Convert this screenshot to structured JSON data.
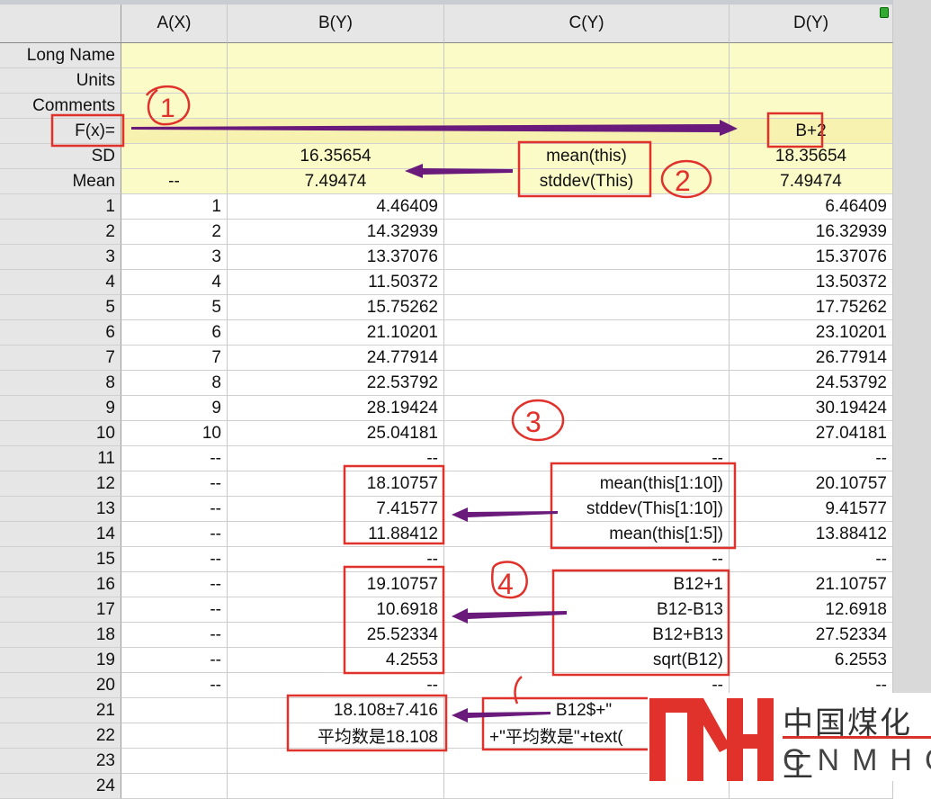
{
  "columns": [
    "A(X)",
    "B(Y)",
    "C(Y)",
    "D(Y)"
  ],
  "meta_rows": [
    {
      "label": "Long Name",
      "cells": [
        "",
        "",
        "",
        ""
      ]
    },
    {
      "label": "Units",
      "cells": [
        "",
        "",
        "",
        ""
      ]
    },
    {
      "label": "Comments",
      "cells": [
        "",
        "",
        "",
        ""
      ]
    },
    {
      "label": "F(x)=",
      "cells": [
        "",
        "",
        "",
        "B+2"
      ]
    },
    {
      "label": "SD",
      "cells": [
        "",
        "16.35654",
        "mean(this)",
        "18.35654"
      ]
    },
    {
      "label": "Mean",
      "cells": [
        "--",
        "7.49474",
        "stddev(This)",
        "7.49474"
      ]
    }
  ],
  "rows": [
    [
      "1",
      "1",
      "4.46409",
      "",
      "6.46409"
    ],
    [
      "2",
      "2",
      "14.32939",
      "",
      "16.32939"
    ],
    [
      "3",
      "3",
      "13.37076",
      "",
      "15.37076"
    ],
    [
      "4",
      "4",
      "11.50372",
      "",
      "13.50372"
    ],
    [
      "5",
      "5",
      "15.75262",
      "",
      "17.75262"
    ],
    [
      "6",
      "6",
      "21.10201",
      "",
      "23.10201"
    ],
    [
      "7",
      "7",
      "24.77914",
      "",
      "26.77914"
    ],
    [
      "8",
      "8",
      "22.53792",
      "",
      "24.53792"
    ],
    [
      "9",
      "9",
      "28.19424",
      "",
      "30.19424"
    ],
    [
      "10",
      "10",
      "25.04181",
      "",
      "27.04181"
    ],
    [
      "11",
      "--",
      "--",
      "--",
      "--"
    ],
    [
      "12",
      "--",
      "18.10757",
      "mean(this[1:10])",
      "20.10757"
    ],
    [
      "13",
      "--",
      "7.41577",
      "stddev(This[1:10])",
      "9.41577"
    ],
    [
      "14",
      "--",
      "11.88412",
      "mean(this[1:5])",
      "13.88412"
    ],
    [
      "15",
      "--",
      "--",
      "--",
      "--"
    ],
    [
      "16",
      "--",
      "19.10757",
      "B12+1",
      "21.10757"
    ],
    [
      "17",
      "--",
      "10.6918",
      "B12-B13",
      "12.6918"
    ],
    [
      "18",
      "--",
      "25.52334",
      "B12+B13",
      "27.52334"
    ],
    [
      "19",
      "--",
      "4.2553",
      "sqrt(B12)",
      "6.2553"
    ],
    [
      "20",
      "--",
      "--",
      "--",
      "--"
    ],
    [
      "21",
      "",
      "18.108±7.416",
      "B12$+\"",
      "--"
    ],
    [
      "22",
      "",
      "平均数是18.108",
      "+\"平均数是\"+text(",
      "--"
    ],
    [
      "23",
      "",
      "",
      "",
      ""
    ],
    [
      "24",
      "",
      "",
      "",
      ""
    ]
  ],
  "annotations": [
    "1",
    "2",
    "3",
    "4"
  ],
  "logo": {
    "mark": "MH",
    "cn": "中国煤化工",
    "en": "CNMHG"
  },
  "colors": {
    "annotation_red": "#e0312b",
    "arrow_purple": "#6a1a7a",
    "meta_yellow": "#fbfbc8"
  }
}
